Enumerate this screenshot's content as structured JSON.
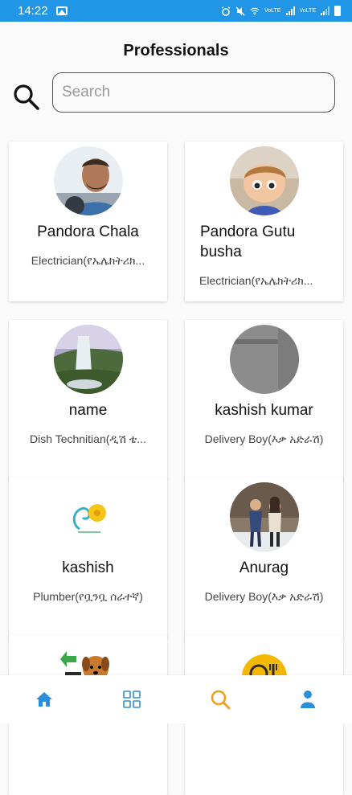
{
  "status_bar": {
    "time": "14:22",
    "tag1": "VoLTE",
    "tag2": "VoLTE"
  },
  "header": {
    "title": "Professionals"
  },
  "search": {
    "placeholder": "Search",
    "value": ""
  },
  "professionals": [
    {
      "name": "Pandora Chala",
      "role": "Electrician(የኤሌክትሪክ..."
    },
    {
      "name": "Pandora Gutu busha",
      "role": "Electrician(የኤሌክትሪክ..."
    },
    {
      "name": "name",
      "role": "Dish Technitian(ዲሽ ቴ..."
    },
    {
      "name": "kashish kumar",
      "role": "Delivery Boy(እቃ አድራሽ)"
    },
    {
      "name": "kashish",
      "role": "Plumber(የቧንቧ ሰራተኛ)"
    },
    {
      "name": "Anurag",
      "role": "Delivery Boy(እቃ አድራሽ)"
    }
  ],
  "bottom_nav": {
    "accent": "#2a8fd8",
    "search_accent": "#f0a020",
    "icons": [
      "home-icon",
      "grid-icon",
      "search-icon",
      "profile-icon"
    ]
  }
}
